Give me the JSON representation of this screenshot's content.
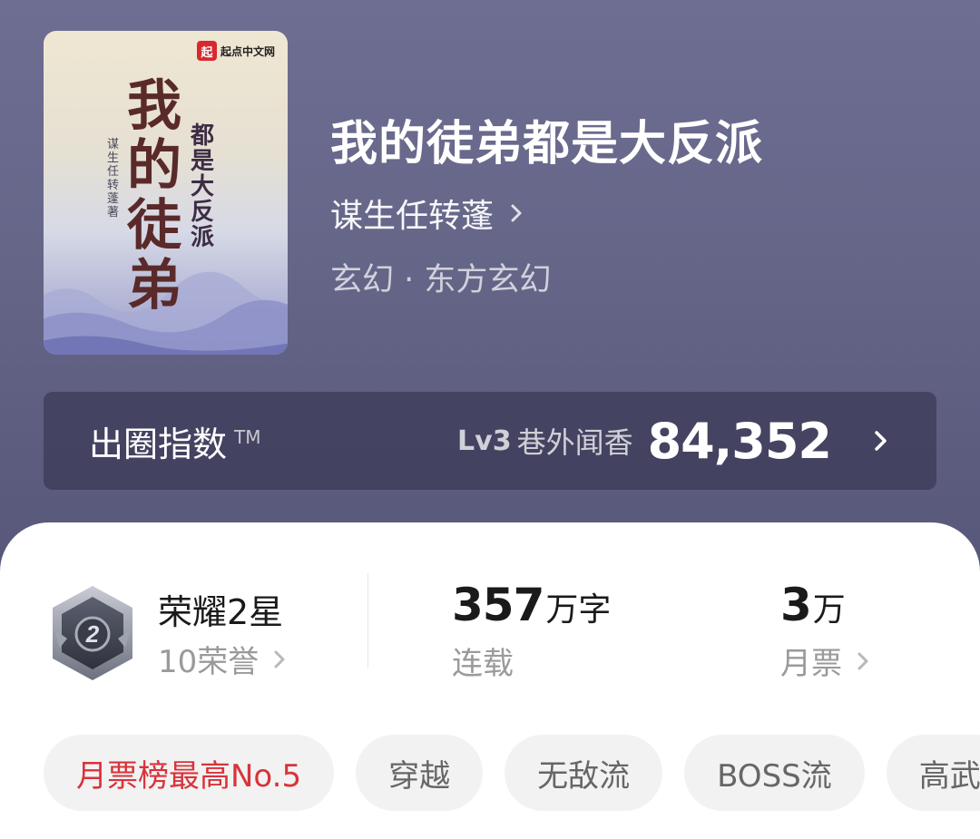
{
  "cover": {
    "brand": "起点中文网",
    "brand_mark": "起",
    "title_chars": [
      "我",
      "的",
      "徒",
      "弟"
    ],
    "subtitle_chars": [
      "都",
      "是",
      "大",
      "反",
      "派"
    ],
    "author_chars": [
      "谋",
      "生",
      "任",
      "转",
      "蓬",
      "著"
    ]
  },
  "book": {
    "title": "我的徒弟都是大反派",
    "author": "谋生任转蓬",
    "genre": "玄幻 · 东方玄幻"
  },
  "index": {
    "label": "出圈指数",
    "tm": "TM",
    "level": "Lv3",
    "level_name": "巷外闻香",
    "score": "84,352"
  },
  "stats": {
    "honor_name": "荣耀2星",
    "honor_count": "10荣誉",
    "badge_number": "2",
    "words_value": "357",
    "words_unit": "万字",
    "words_label": "连载",
    "ticket_value": "3",
    "ticket_unit": "万",
    "ticket_label": "月票"
  },
  "tags": [
    "月票榜最高No.5",
    "穿越",
    "无敌流",
    "BOSS流",
    "高武"
  ],
  "colors": {
    "header_bg": "#626386",
    "hot_tag": "#d8333b",
    "brand_red": "#d8282e"
  }
}
